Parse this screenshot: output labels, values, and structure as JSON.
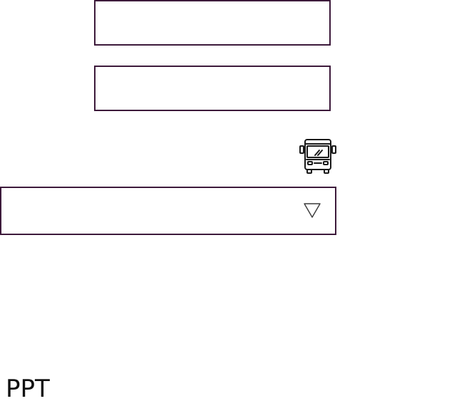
{
  "form": {
    "field_1": {
      "value": "",
      "placeholder": ""
    },
    "field_2": {
      "value": "",
      "placeholder": ""
    },
    "transport_icon": "bus-icon",
    "dropdown": {
      "selected": "",
      "icon": "caret-down-icon"
    }
  },
  "footer": {
    "label": "PPT"
  },
  "colors": {
    "border": "#3d1a3b",
    "icon": "#1a1a1a"
  }
}
